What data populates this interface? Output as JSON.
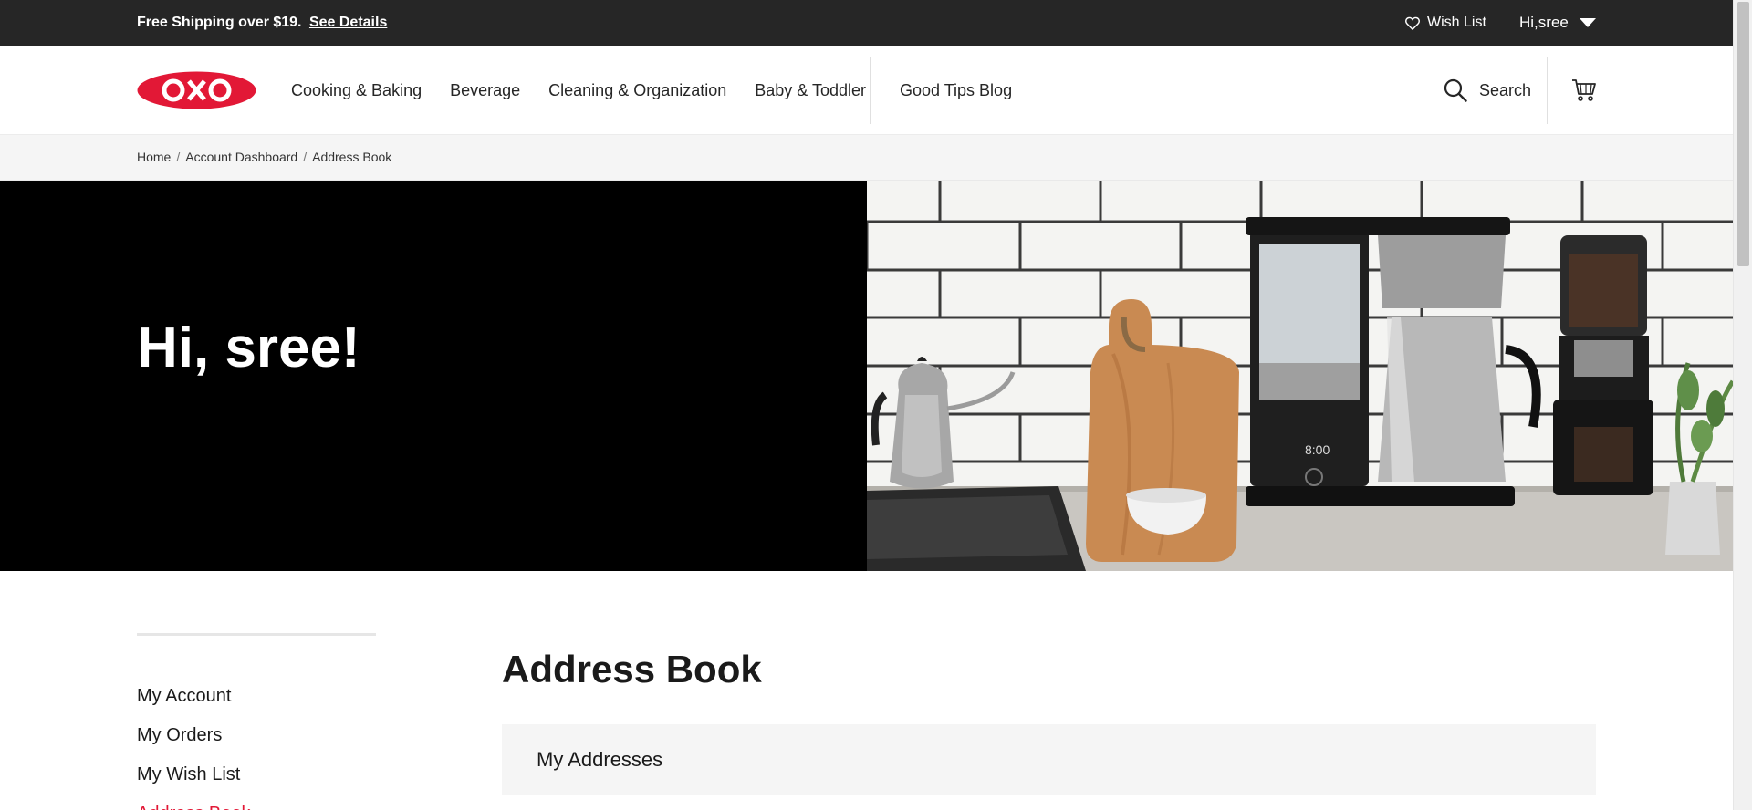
{
  "topbar": {
    "promo_text": "Free Shipping over $19.",
    "promo_link": "See Details",
    "wishlist_label": "Wish List",
    "user_label": "Hi,sree"
  },
  "nav": {
    "logo_text": "OXO",
    "links": [
      "Cooking & Baking",
      "Beverage",
      "Cleaning & Organization",
      "Baby & Toddler"
    ],
    "blog": "Good Tips Blog",
    "search_label": "Search"
  },
  "breadcrumb": [
    "Home",
    "Account Dashboard",
    "Address Book"
  ],
  "hero": {
    "greeting": "Hi, sree!"
  },
  "sidebar": {
    "items": [
      {
        "label": "My Account"
      },
      {
        "label": "My Orders"
      },
      {
        "label": "My Wish List"
      },
      {
        "label": "Address Book"
      }
    ]
  },
  "main": {
    "title": "Address Book",
    "panel_title": "My Addresses"
  },
  "colors": {
    "brand_red": "#e21836",
    "topbar_bg": "#262626",
    "hero_bg": "#000000"
  }
}
